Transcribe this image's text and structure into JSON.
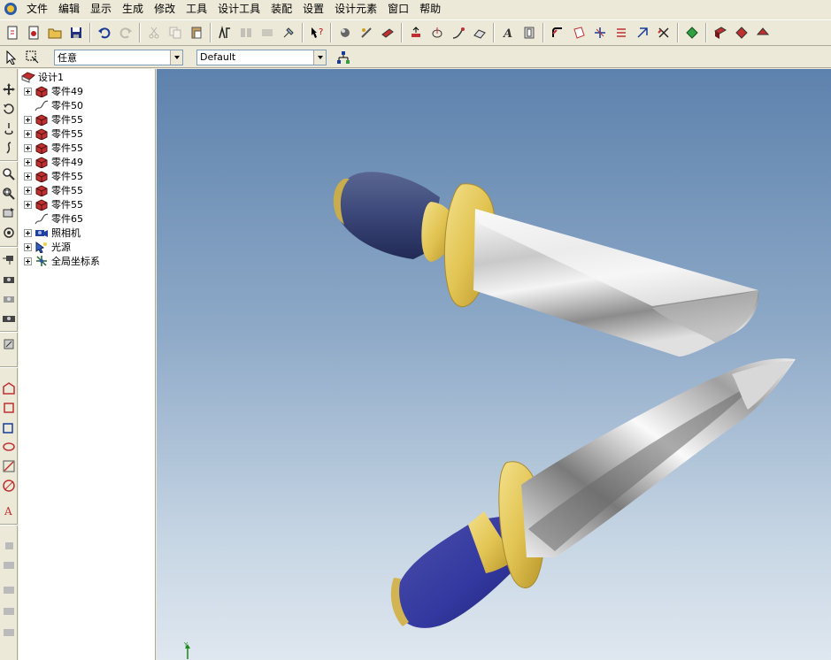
{
  "menubar": {
    "items": [
      "文件",
      "编辑",
      "显示",
      "生成",
      "修改",
      "工具",
      "设计工具",
      "装配",
      "设置",
      "设计元素",
      "窗口",
      "帮助"
    ]
  },
  "toolbar2": {
    "select_filter_value": "任意",
    "style_value": "Default"
  },
  "tree": {
    "root_label": "设计1",
    "items": [
      {
        "label": "零件49",
        "icon": "part-icon",
        "expandable": true
      },
      {
        "label": "零件50",
        "icon": "curve-icon",
        "expandable": false
      },
      {
        "label": "零件55",
        "icon": "part-icon",
        "expandable": true
      },
      {
        "label": "零件55",
        "icon": "part-icon",
        "expandable": true
      },
      {
        "label": "零件55",
        "icon": "part-icon",
        "expandable": true
      },
      {
        "label": "零件49",
        "icon": "part-icon",
        "expandable": true
      },
      {
        "label": "零件55",
        "icon": "part-icon",
        "expandable": true
      },
      {
        "label": "零件55",
        "icon": "part-icon",
        "expandable": true
      },
      {
        "label": "零件55",
        "icon": "part-icon",
        "expandable": true
      },
      {
        "label": "零件65",
        "icon": "curve-icon",
        "expandable": false
      },
      {
        "label": "照相机",
        "icon": "camera-icon",
        "expandable": true
      },
      {
        "label": "光源",
        "icon": "light-icon",
        "expandable": true
      },
      {
        "label": "全局坐标系",
        "icon": "axis-icon",
        "expandable": true
      }
    ]
  },
  "viewport": {
    "axis_label": "Y"
  },
  "colors": {
    "handle_blue": "#3e4a86",
    "guard_gold": "#e0c25a",
    "blade_silver": "#d8d8d8",
    "part_red": "#c0302a"
  }
}
